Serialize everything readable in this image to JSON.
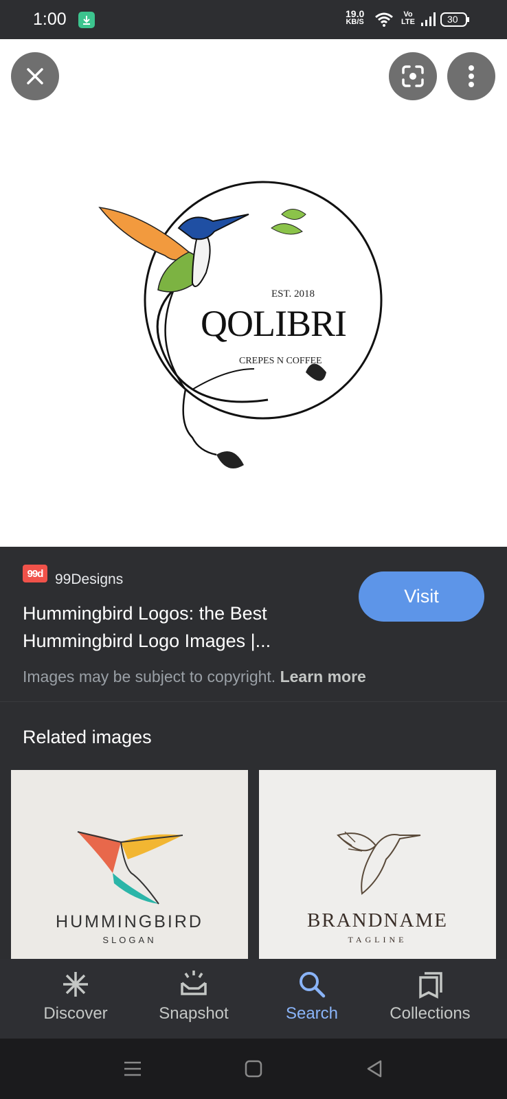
{
  "status_bar": {
    "time": "1:00",
    "net_speed_value": "19.0",
    "net_speed_unit": "KB/S",
    "volte_top": "Vo",
    "volte_bottom": "LTE",
    "battery": "30"
  },
  "viewer": {
    "logo_text": {
      "est": "EST. 2018",
      "brand": "QOLIBRI",
      "tagline": "CREPES N COFFEE"
    }
  },
  "result": {
    "source_badge": "99d",
    "source_name": "99Designs",
    "title": "Hummingbird Logos: the Best Hummingbird Logo Images |...",
    "copyright_text": "Images may be subject to copyright.",
    "learn_more": "Learn more",
    "visit_label": "Visit"
  },
  "related": {
    "heading": "Related images",
    "items": [
      {
        "title": "HUMMINGBIRD",
        "subtitle": "SLOGAN"
      },
      {
        "title": "BRANDNAME",
        "subtitle": "TAGLINE"
      }
    ]
  },
  "bottom_nav": {
    "items": [
      {
        "label": "Discover",
        "icon": "asterisk-icon"
      },
      {
        "label": "Snapshot",
        "icon": "snapshot-icon"
      },
      {
        "label": "Search",
        "icon": "search-icon",
        "active": true
      },
      {
        "label": "Collections",
        "icon": "collections-icon"
      }
    ]
  },
  "colors": {
    "accent": "#8ab4f8",
    "visit_button": "#5d95e8",
    "background": "#2d2e31",
    "source_badge": "#f0524a"
  }
}
